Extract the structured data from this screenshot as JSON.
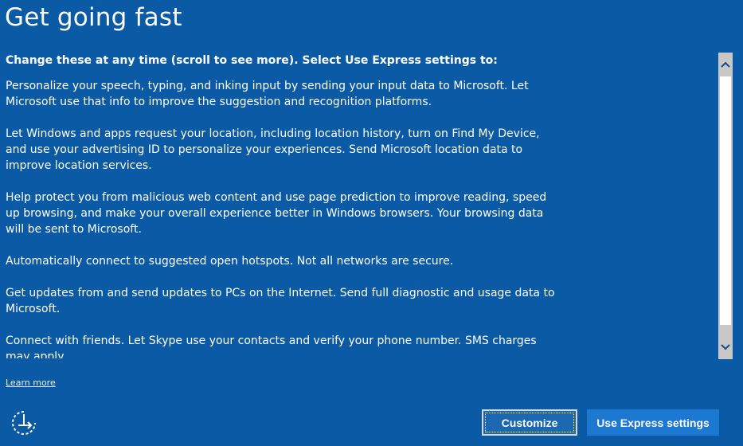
{
  "page": {
    "title": "Get going fast"
  },
  "content": {
    "intro": "Change these at any time (scroll to see more). Select Use Express settings to:",
    "paragraphs": [
      "Personalize your speech, typing, and inking input by sending your input data to Microsoft. Let Microsoft use that info to improve the suggestion and recognition platforms.",
      "Let Windows and apps request your location, including location history, turn on Find My Device, and use your advertising ID to personalize your experiences. Send Microsoft location data to improve location services.",
      "Help protect you from malicious web content and use page prediction to improve reading, speed up browsing, and make your overall experience better in Windows browsers. Your browsing data will be sent to Microsoft.",
      "Automatically connect to suggested open hotspots. Not all networks are secure.",
      "Get updates from and send updates to PCs on the Internet. Send full diagnostic and usage data to Microsoft.",
      "Connect with friends. Let Skype use your contacts and verify your phone number. SMS charges may apply."
    ]
  },
  "links": {
    "learn_more": "Learn more"
  },
  "buttons": {
    "customize": "Customize",
    "express": "Use Express settings"
  },
  "icons": {
    "ease_of_access": "ease-of-access-icon",
    "scroll_up": "chevron-up-icon",
    "scroll_down": "chevron-down-icon"
  },
  "colors": {
    "background": "#0a5aa6",
    "express_button": "#1d78d1",
    "scrollbar_track": "#c8c8c8"
  }
}
